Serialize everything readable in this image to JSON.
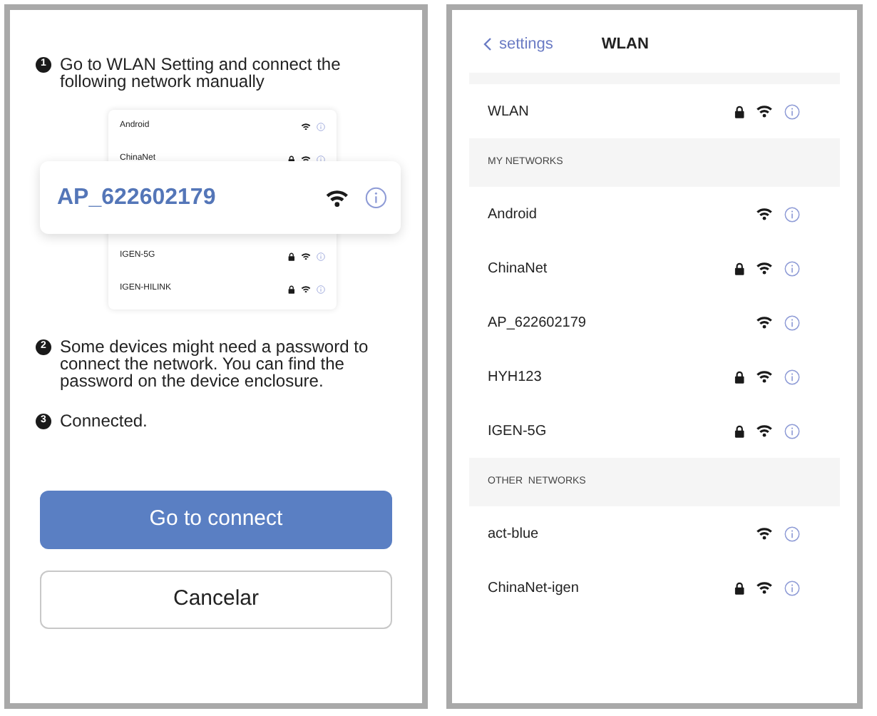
{
  "guide": {
    "steps": [
      {
        "number": "1",
        "text": "Go to WLAN Setting and connect the following network manually"
      },
      {
        "number": "2",
        "text": "Some devices might need a password to connect the network. You can find the password on the device enclosure."
      },
      {
        "number": "3",
        "text": "Connected."
      }
    ],
    "illustration": {
      "networks_above": [
        {
          "name": "Android",
          "locked": false
        },
        {
          "name": "ChinaNet",
          "locked": true
        }
      ],
      "highlighted": {
        "name": "AP_622602179",
        "locked": false
      },
      "networks_below": [
        {
          "name": "IGEN-5G",
          "locked": true
        },
        {
          "name": "IGEN-HILINK",
          "locked": true
        }
      ]
    },
    "buttons": [
      {
        "label": "Go to connect",
        "kind": "primary"
      },
      {
        "label": "Cancelar",
        "kind": "secondary"
      }
    ]
  },
  "wlan": {
    "back_label": "settings",
    "title": "WLAN",
    "current": {
      "name": "WLAN",
      "locked": true
    },
    "sections": [
      {
        "heading": "MY NETWORKS",
        "networks": [
          {
            "name": "Android",
            "locked": false
          },
          {
            "name": "ChinaNet",
            "locked": true
          },
          {
            "name": "AP_622602179",
            "locked": false
          },
          {
            "name": "HYH123",
            "locked": true
          },
          {
            "name": "IGEN-5G",
            "locked": true
          }
        ]
      },
      {
        "heading": "OTHER  NETWORKS",
        "networks": [
          {
            "name": "act-blue",
            "locked": false
          },
          {
            "name": "ChinaNet-igen",
            "locked": true
          }
        ]
      }
    ]
  }
}
